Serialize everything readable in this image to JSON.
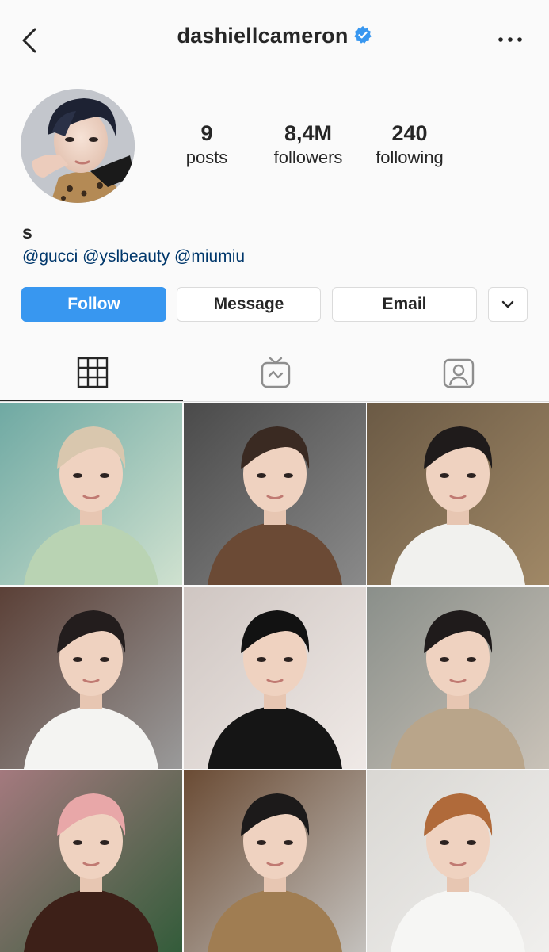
{
  "header": {
    "username": "dashiellcameron",
    "verified": true,
    "back_icon": "chevron-left-icon",
    "more_icon": "more-horizontal-icon"
  },
  "profile": {
    "avatar_icon": "profile-avatar",
    "stats": {
      "posts": {
        "value": "9",
        "label": "posts"
      },
      "followers": {
        "value": "8,4M",
        "label": "followers"
      },
      "following": {
        "value": "240",
        "label": "following"
      }
    },
    "bio": {
      "name": "s",
      "links": "@gucci @yslbeauty @miumiu"
    }
  },
  "actions": {
    "follow_label": "Follow",
    "message_label": "Message",
    "email_label": "Email",
    "suggest_icon": "chevron-down-icon"
  },
  "tabs": [
    {
      "name": "grid",
      "icon": "grid-icon",
      "active": true
    },
    {
      "name": "igtv",
      "icon": "igtv-icon",
      "active": false
    },
    {
      "name": "tagged",
      "icon": "tagged-person-icon",
      "active": false
    }
  ],
  "colors": {
    "accent": "#3897f0",
    "link": "#00376b",
    "text": "#262626",
    "border": "#dbdbdb",
    "background": "#fafafa"
  },
  "posts": [
    {
      "bg": [
        "#6fa9a3",
        "#cfe1cf"
      ],
      "shirt": "#b9d3b3",
      "hair": "#d9c7ae"
    },
    {
      "bg": [
        "#4a4a4a",
        "#8a8a8a"
      ],
      "shirt": "#6b4a35",
      "hair": "#3a2a22"
    },
    {
      "bg": [
        "#6b5a45",
        "#a08866"
      ],
      "shirt": "#f1f1ee",
      "hair": "#1f1b1b"
    },
    {
      "bg": [
        "#5b4037",
        "#9a9a9a"
      ],
      "shirt": "#f4f4f2",
      "hair": "#231d1d"
    },
    {
      "bg": [
        "#cfc6c2",
        "#efe9e6"
      ],
      "shirt": "#151515",
      "hair": "#121212"
    },
    {
      "bg": [
        "#8a8f8a",
        "#c9c2b8"
      ],
      "shirt": "#b9a58a",
      "hair": "#1f1b1b"
    },
    {
      "bg": [
        "#a4797e",
        "#335c3a"
      ],
      "shirt": "#3d2018",
      "hair": "#e8a7a8"
    },
    {
      "bg": [
        "#6a4b34",
        "#c4c1bd"
      ],
      "shirt": "#a07d52",
      "hair": "#1c1a1a"
    },
    {
      "bg": [
        "#d9d7d3",
        "#f0efed"
      ],
      "shirt": "#f6f6f4",
      "hair": "#b06a3a"
    }
  ]
}
